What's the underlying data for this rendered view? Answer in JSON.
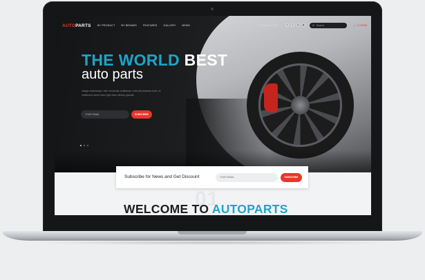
{
  "nav": {
    "logo_prefix": "AUTO",
    "logo_suffix": "PARTS",
    "links": [
      "BY PRODUCT",
      "BY BRANDS",
      "FEATURES",
      "GALLERY",
      "NEWS"
    ],
    "phone": "✆ 1 800 000 00 00",
    "search_placeholder": "Search",
    "cart": "🛒 0 ITEMS"
  },
  "hero": {
    "title_highlight": "THE WORLD",
    "title_rest": "BEST",
    "subtitle": "auto parts",
    "description": "Integer scelerisque, nibh vel iaculis vestibulum, enim elit pharetra enim, ut vestibulum lorem risus eget risus ultrices gravida.",
    "email_placeholder": "YOUR EMAIL",
    "subscribe_label": "SUBSCRIBE",
    "slides_total": 3,
    "slide_active": 1
  },
  "subscribe": {
    "text": "Subscribe for News and Get Discount",
    "email_placeholder": "YOUR EMAIL",
    "button_label": "SUBSCRIBE"
  },
  "welcome": {
    "ghost_number": "01",
    "title_prefix": "WELCOME TO",
    "title_highlight": "AUTOPARTS"
  },
  "colors": {
    "accent_red": "#e8362a",
    "accent_blue": "#1aa6c9"
  }
}
